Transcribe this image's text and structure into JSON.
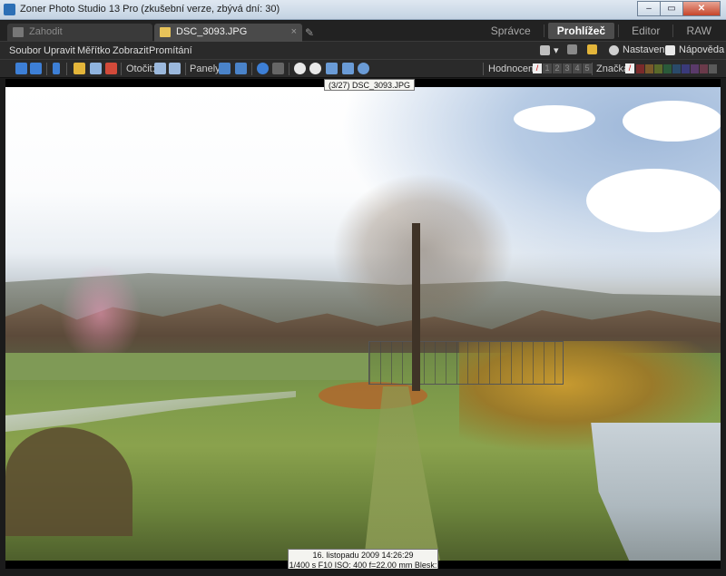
{
  "window": {
    "title": "Zoner Photo Studio 13 Pro (zkušební verze, zbývá dní: 30)",
    "controls": {
      "minimize": "–",
      "maximize": "▭",
      "close": "✕"
    }
  },
  "tabs": [
    {
      "label": "Zahodit",
      "icon": "discard-icon"
    },
    {
      "label": "DSC_3093.JPG",
      "icon": "image-file-icon",
      "close": "×"
    }
  ],
  "modes": {
    "items": [
      "Správce",
      "Prohlížeč",
      "Editor",
      "RAW"
    ],
    "active": "Prohlížeč"
  },
  "menu": {
    "items": [
      "Soubor",
      "Upravit",
      "Měřítko",
      "Zobrazit",
      "Promítání"
    ],
    "settings": "Nastavení",
    "help": "Nápověda"
  },
  "toolbar": {
    "rotate_label": "Otočit:",
    "panels_label": "Panely:",
    "rating_label": "Hodnocení:",
    "rating_values": [
      "1",
      "2",
      "3",
      "4",
      "5"
    ],
    "tag_label": "Značka:",
    "tag_colors": [
      "#7a2a2a",
      "#7a5a2a",
      "#5a6a2a",
      "#2a5a3a",
      "#2a4a6a",
      "#3a3a7a",
      "#5a3a6a",
      "#6a3a4a",
      "#5a5a5a"
    ]
  },
  "viewer": {
    "tooltip": "(3/27) DSC_3093.JPG",
    "exif_line1": "16. listopadu 2009 14:26:29",
    "exif_line2": "1/400 s F10 ISO: 400 f=22.00 mm Blesk: Ne"
  }
}
